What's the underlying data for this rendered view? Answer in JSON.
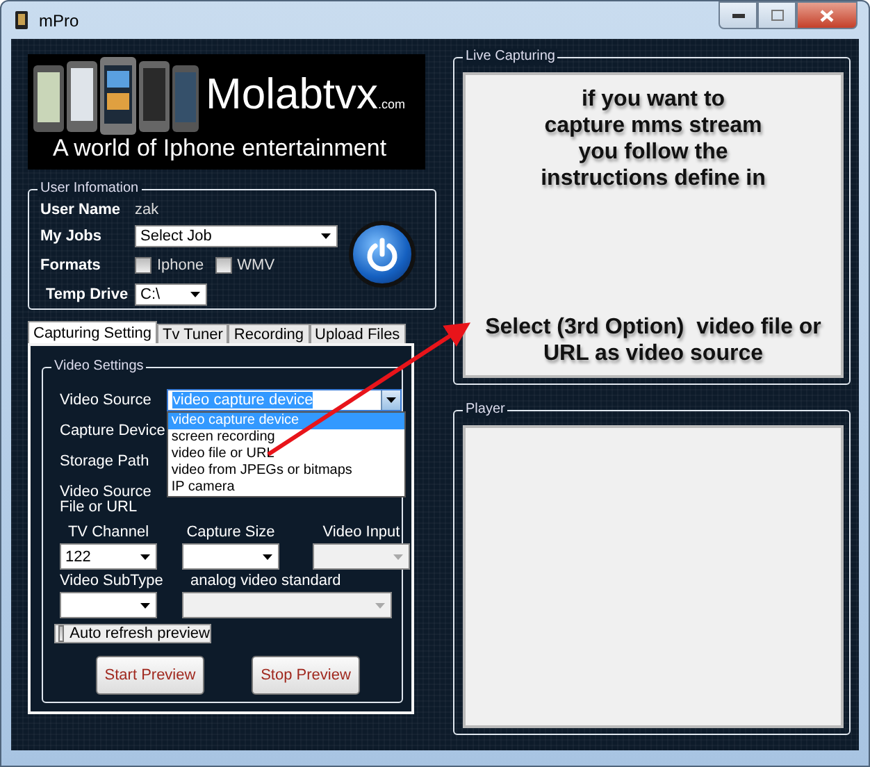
{
  "window": {
    "title": "mPro"
  },
  "banner": {
    "brand": "Molabtvx",
    "domain": ".com",
    "tagline": "A world of Iphone entertainment"
  },
  "user_information": {
    "title": "User Infomation",
    "user_name_label": "User Name",
    "user_name": "zak",
    "jobs_label": "My Jobs",
    "jobs_value": "Select Job",
    "formats_label": "Formats",
    "formats": [
      {
        "label": "Iphone",
        "checked": false
      },
      {
        "label": "WMV",
        "checked": false
      }
    ],
    "temp_drive_label": "Temp Drive",
    "temp_drive": "C:\\"
  },
  "tabs": [
    {
      "label": "Capturing Setting",
      "selected": true
    },
    {
      "label": "Tv Tuner",
      "selected": false
    },
    {
      "label": "Recording",
      "selected": false
    },
    {
      "label": "Upload Files",
      "selected": false
    }
  ],
  "video_settings": {
    "title": "Video Settings",
    "video_source_label": "Video Source",
    "video_source": "video capture device",
    "video_source_options": [
      {
        "label": "video capture device",
        "selected": true
      },
      {
        "label": "screen recording",
        "selected": false
      },
      {
        "label": "video file or URL",
        "selected": false
      },
      {
        "label": "video from JPEGs or bitmaps",
        "selected": false
      },
      {
        "label": "IP camera",
        "selected": false
      }
    ],
    "capture_device_label": "Capture Device",
    "storage_path_label": "Storage Path",
    "file_or_url_label": "Video Source File or URL",
    "combos": [
      {
        "label": "TV Channel",
        "value": "122",
        "disabled": false
      },
      {
        "label": "Capture Size",
        "disabled": false
      },
      {
        "label": "Video Input",
        "disabled": true
      },
      {
        "label": "Video SubType",
        "disabled": false
      },
      {
        "label": "analog video standard",
        "disabled": true
      }
    ],
    "auto_refresh": {
      "label": "Auto refresh preview",
      "checked": false
    },
    "buttons": [
      "Start Preview",
      "Stop Preview"
    ]
  },
  "live_capturing": {
    "title": "Live Capturing",
    "instructions": "if you want to capture mms stream you follow the instructions define in",
    "note": "Select (3rd Option)  video file or URL as video source"
  },
  "player": {
    "title": "Player"
  }
}
